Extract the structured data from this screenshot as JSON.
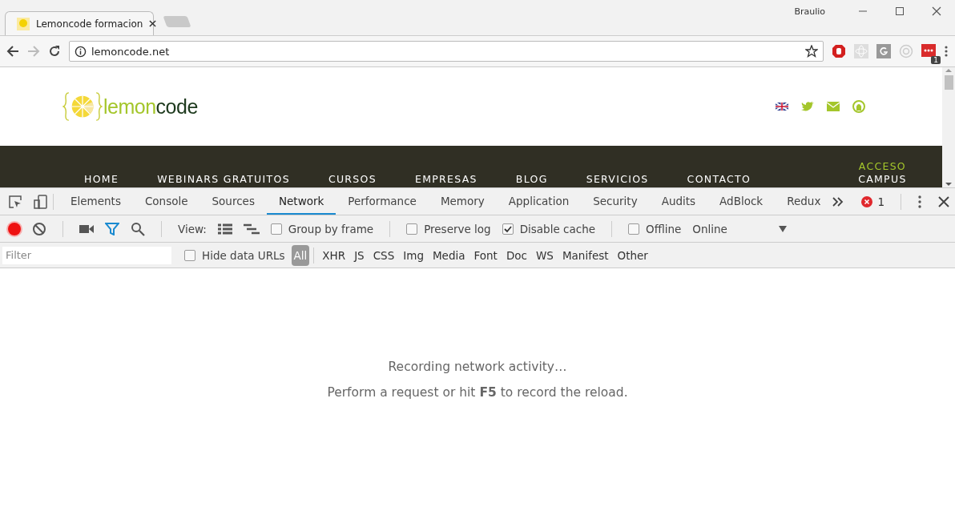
{
  "browser": {
    "profile": "Braulio",
    "tabs": [
      {
        "title": "Lemoncode formacion",
        "selected": true
      }
    ],
    "address": "lemoncode.net",
    "extension_badge": "1"
  },
  "site": {
    "logo_parts": [
      "lemon",
      "code"
    ],
    "nav": [
      {
        "kind": "plain",
        "lines": [
          "HOME"
        ]
      },
      {
        "kind": "plain",
        "lines": [
          "WEBINARS GRATUITOS"
        ]
      },
      {
        "kind": "plain",
        "lines": [
          "CURSOS"
        ]
      },
      {
        "kind": "plain",
        "lines": [
          "EMPRESAS"
        ]
      },
      {
        "kind": "plain",
        "lines": [
          "BLOG"
        ]
      },
      {
        "kind": "plain",
        "lines": [
          "SERVICIOS"
        ]
      },
      {
        "kind": "plain",
        "lines": [
          "CONTACTO"
        ]
      },
      {
        "kind": "highlight",
        "lines": [
          "ACCESO",
          "CAMPUS"
        ]
      }
    ]
  },
  "devtools": {
    "tabs": [
      {
        "label": "Elements",
        "selected": false
      },
      {
        "label": "Console",
        "selected": false
      },
      {
        "label": "Sources",
        "selected": false
      },
      {
        "label": "Network",
        "selected": true
      },
      {
        "label": "Performance",
        "selected": false
      },
      {
        "label": "Memory",
        "selected": false
      },
      {
        "label": "Application",
        "selected": false
      },
      {
        "label": "Security",
        "selected": false
      },
      {
        "label": "Audits",
        "selected": false
      },
      {
        "label": "AdBlock",
        "selected": false
      },
      {
        "label": "Redux",
        "selected": false
      }
    ],
    "error_count": "1",
    "recording": true,
    "view_label": "View:",
    "options": [
      {
        "label": "Group by frame",
        "checked": false
      },
      {
        "label": "Preserve log",
        "checked": false
      },
      {
        "label": "Disable cache",
        "checked": true
      },
      {
        "label": "Offline",
        "checked": false
      }
    ],
    "throttling": "Online",
    "filter": {
      "placeholder": "Filter"
    },
    "hide_data_urls": {
      "label": "Hide data URLs",
      "checked": false
    },
    "types": [
      {
        "label": "All",
        "selected": true
      },
      {
        "label": "XHR",
        "selected": false
      },
      {
        "label": "JS",
        "selected": false
      },
      {
        "label": "CSS",
        "selected": false
      },
      {
        "label": "Img",
        "selected": false
      },
      {
        "label": "Media",
        "selected": false
      },
      {
        "label": "Font",
        "selected": false
      },
      {
        "label": "Doc",
        "selected": false
      },
      {
        "label": "WS",
        "selected": false
      },
      {
        "label": "Manifest",
        "selected": false
      },
      {
        "label": "Other",
        "selected": false
      }
    ],
    "messages": [
      "Recording network activity…",
      "Perform a request or hit **F5** to record the reload."
    ]
  }
}
